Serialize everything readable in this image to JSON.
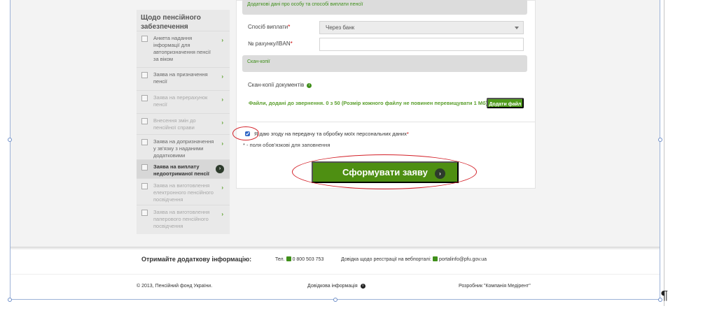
{
  "sidebar": {
    "title": "Щодо пенсійного забезпечення",
    "items": [
      {
        "label": "Анкета надання інформації для автопризначення пенсії за віком",
        "icon": "form-icon"
      },
      {
        "label": "Заява на призначення пенсії",
        "icon": "document-icon"
      },
      {
        "label": "Заява на перерахунок пенсії",
        "icon": "recalc-icon"
      },
      {
        "label": "Внесення змін до пенсійної справи",
        "icon": "folder-icon"
      },
      {
        "label": "Заява на допризначення у зв'язку з наданими додатковими документами",
        "icon": "folder-icon"
      },
      {
        "label": "Заява на виплату недоотриманої пенсії",
        "icon": "folder-icon"
      },
      {
        "label": "Заява на виготовлення електронного пенсійного посвідчення",
        "icon": "card-icon"
      },
      {
        "label": "Заява на виготовлення паперового пенсійного посвідчення",
        "icon": "card-icon"
      }
    ]
  },
  "form": {
    "top_section": "Додаткові дані про особу та способі виплати пенсії",
    "payment_method_label": "Спосіб виплати",
    "payment_method_value": "Через банк",
    "account_label": "№ рахунку/IBAN",
    "account_value": "",
    "scan_section": "Скан-копії",
    "scan_docs_label": "Скан-копії документів",
    "files_info": "Файли, додані до звернення. 0 з 50 (Розмір кожного файлу не повинен перевищувати 1 Мб)",
    "add_file_label": "Додати файл",
    "consent_label": "Я даю згоду на передачу та обробку моїх персональних даних",
    "required_note": "* - поля обов'язкові для заповнення",
    "submit_label": "Сформувати заяву"
  },
  "footer": {
    "info_title": "Отримайте додаткову інформацію:",
    "phone_label": "Тел.",
    "phone": "0 800 503 753",
    "registration_help": "Довідка щодо реєстрації на вебпорталі:",
    "email": "portalinfo@pfu.gov.ua",
    "copyright": "© 2013, Пенсійний фонд України.",
    "reference_info": "Довідкова інформація",
    "developer": "Розробник \"Компанія Медірент\""
  },
  "colors": {
    "accent": "#4e8f12",
    "link": "#3f8f1a",
    "annotation": "#d31f27"
  }
}
